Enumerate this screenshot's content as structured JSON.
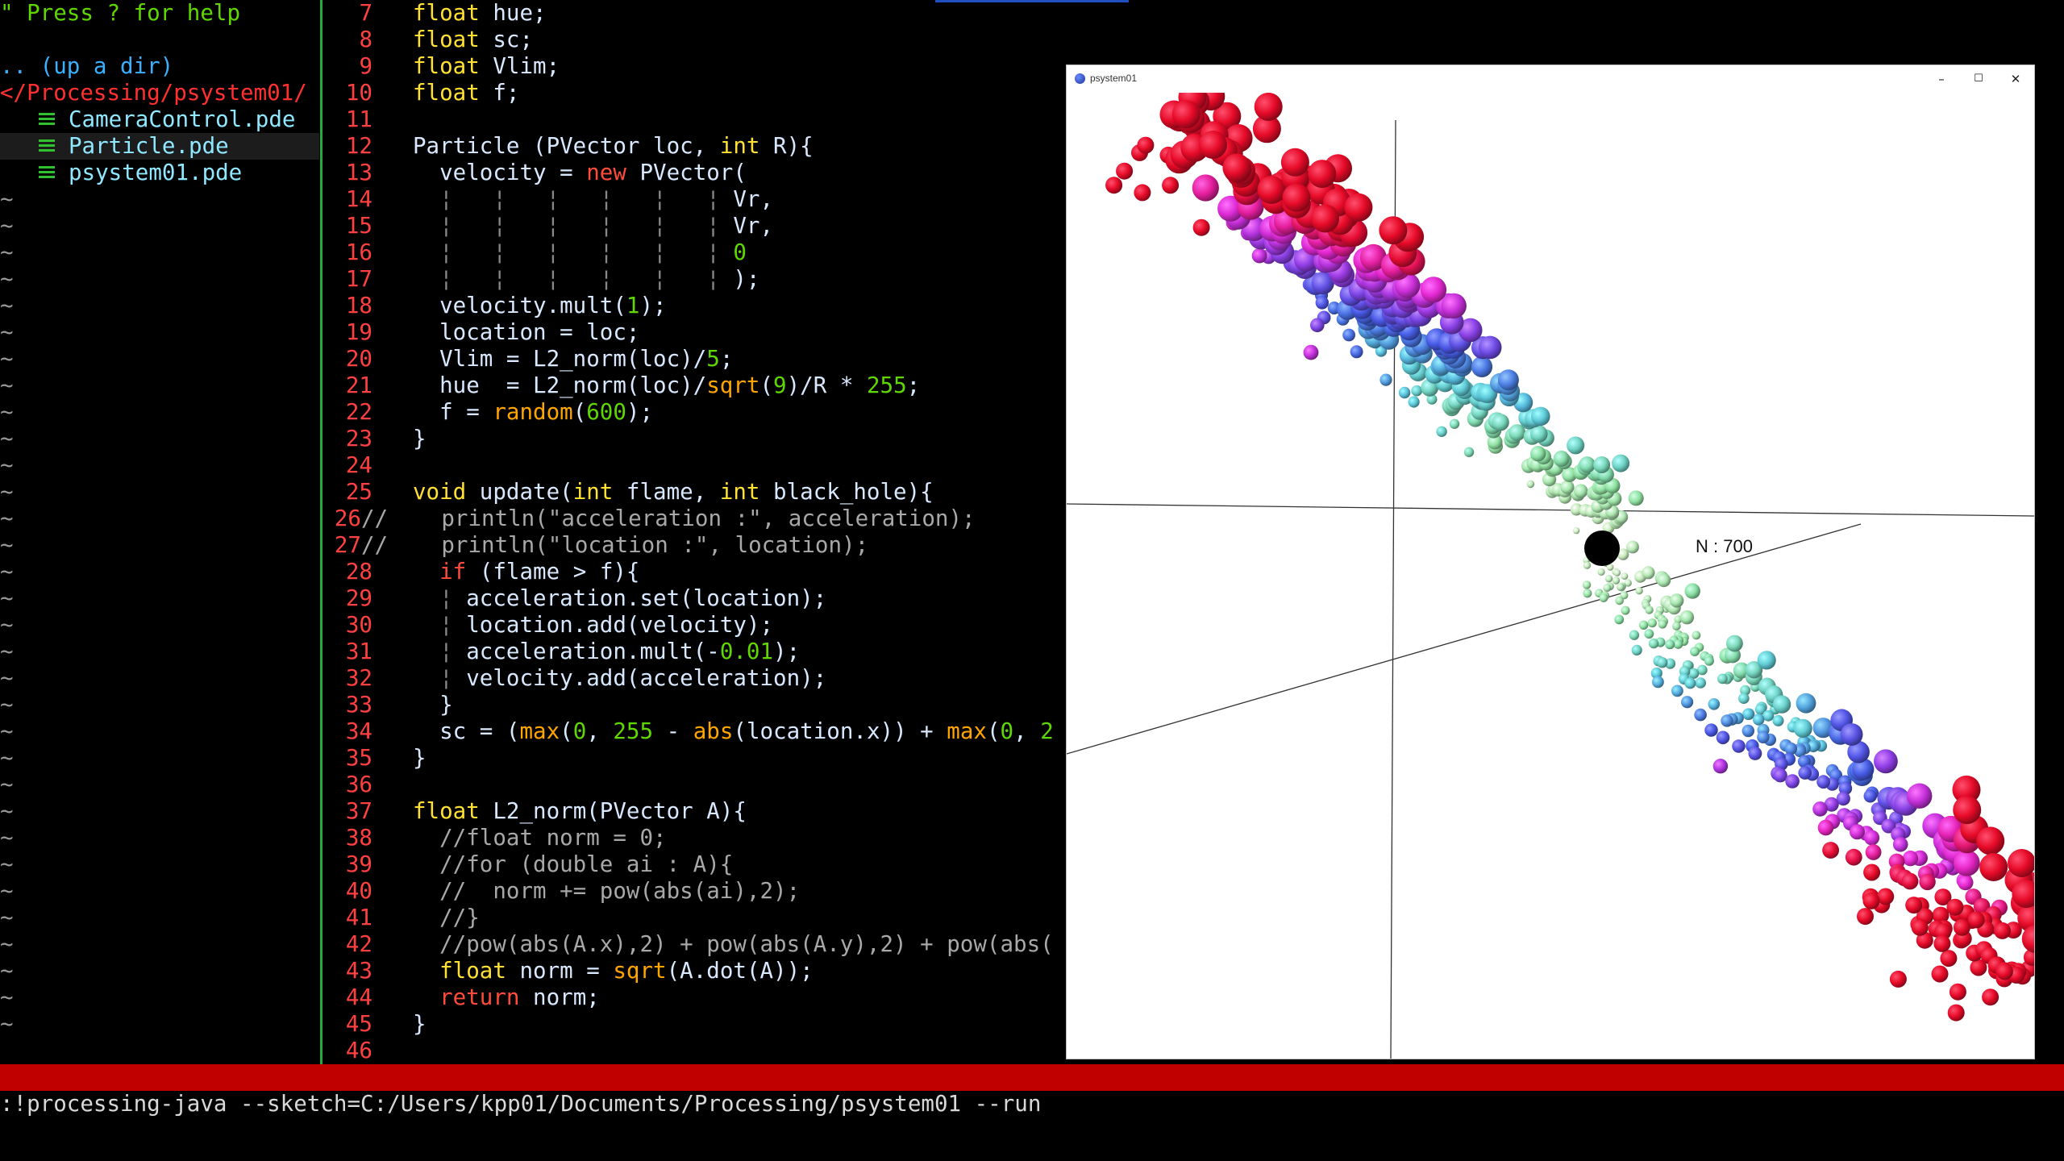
{
  "tree": {
    "help": "\" Press ? for help",
    "up_dir": ".. (up a dir)",
    "path": "</Processing/psystem01/",
    "files": [
      "CameraControl.pde",
      "Particle.pde",
      "psystem01.pde"
    ],
    "selected_index": 1,
    "tilde": "~",
    "tilde_count": 32
  },
  "code": {
    "lines": [
      {
        "n": "7",
        "t": [
          [
            "kw",
            "float"
          ],
          [
            "plain",
            " hue;"
          ]
        ]
      },
      {
        "n": "8",
        "t": [
          [
            "kw",
            "float"
          ],
          [
            "plain",
            " sc;"
          ]
        ]
      },
      {
        "n": "9",
        "t": [
          [
            "kw",
            "float"
          ],
          [
            "plain",
            " Vlim;"
          ]
        ]
      },
      {
        "n": "10",
        "t": [
          [
            "kw",
            "float"
          ],
          [
            "plain",
            " f;"
          ]
        ]
      },
      {
        "n": "11",
        "t": []
      },
      {
        "n": "12",
        "t": [
          [
            "plain",
            "Particle (PVector loc, "
          ],
          [
            "kw",
            "int"
          ],
          [
            "plain",
            " R){"
          ]
        ]
      },
      {
        "n": "13",
        "t": [
          [
            "plain",
            "  velocity = "
          ],
          [
            "kr",
            "new"
          ],
          [
            "plain",
            " PVector("
          ]
        ]
      },
      {
        "n": "14",
        "t": [
          [
            "guide",
            "  ¦   ¦   ¦   ¦   ¦   ¦ "
          ],
          [
            "plain",
            "Vr,"
          ]
        ]
      },
      {
        "n": "15",
        "t": [
          [
            "guide",
            "  ¦   ¦   ¦   ¦   ¦   ¦ "
          ],
          [
            "plain",
            "Vr,"
          ]
        ]
      },
      {
        "n": "16",
        "t": [
          [
            "guide",
            "  ¦   ¦   ¦   ¦   ¦   ¦ "
          ],
          [
            "num",
            "0"
          ]
        ]
      },
      {
        "n": "17",
        "t": [
          [
            "guide",
            "  ¦   ¦   ¦   ¦   ¦   ¦ "
          ],
          [
            "plain",
            ");"
          ]
        ]
      },
      {
        "n": "18",
        "t": [
          [
            "plain",
            "  velocity.mult("
          ],
          [
            "num",
            "1"
          ],
          [
            "plain",
            ");"
          ]
        ]
      },
      {
        "n": "19",
        "t": [
          [
            "plain",
            "  location = loc;"
          ]
        ]
      },
      {
        "n": "20",
        "t": [
          [
            "plain",
            "  Vlim = L2_norm(loc)/"
          ],
          [
            "num",
            "5"
          ],
          [
            "plain",
            ";"
          ]
        ]
      },
      {
        "n": "21",
        "t": [
          [
            "plain",
            "  hue  = L2_norm(loc)/"
          ],
          [
            "fn",
            "sqrt"
          ],
          [
            "plain",
            "("
          ],
          [
            "num",
            "9"
          ],
          [
            "plain",
            ")/R * "
          ],
          [
            "num",
            "255"
          ],
          [
            "plain",
            ";"
          ]
        ]
      },
      {
        "n": "22",
        "t": [
          [
            "plain",
            "  f = "
          ],
          [
            "fn",
            "random"
          ],
          [
            "plain",
            "("
          ],
          [
            "num",
            "600"
          ],
          [
            "plain",
            ");"
          ]
        ]
      },
      {
        "n": "23",
        "t": [
          [
            "plain",
            "}"
          ]
        ]
      },
      {
        "n": "24",
        "t": []
      },
      {
        "n": "25",
        "t": [
          [
            "kw",
            "void"
          ],
          [
            "plain",
            " update("
          ],
          [
            "kw",
            "int"
          ],
          [
            "plain",
            " flame, "
          ],
          [
            "kw",
            "int"
          ],
          [
            "plain",
            " black_hole){"
          ]
        ]
      },
      {
        "n": "26",
        "t": [
          [
            "cmt",
            "//    println(\"acceleration :\", acceleration);"
          ]
        ],
        "out": true
      },
      {
        "n": "27",
        "t": [
          [
            "cmt",
            "//    println(\"location :\", location);"
          ]
        ],
        "out": true
      },
      {
        "n": "28",
        "t": [
          [
            "plain",
            "  "
          ],
          [
            "kr",
            "if"
          ],
          [
            "plain",
            " (flame > f){"
          ]
        ]
      },
      {
        "n": "29",
        "t": [
          [
            "guide",
            "  ¦ "
          ],
          [
            "plain",
            "acceleration.set(location);"
          ]
        ]
      },
      {
        "n": "30",
        "t": [
          [
            "guide",
            "  ¦ "
          ],
          [
            "plain",
            "location.add(velocity);"
          ]
        ]
      },
      {
        "n": "31",
        "t": [
          [
            "guide",
            "  ¦ "
          ],
          [
            "plain",
            "acceleration.mult(-"
          ],
          [
            "num",
            "0.01"
          ],
          [
            "plain",
            ");"
          ]
        ]
      },
      {
        "n": "32",
        "t": [
          [
            "guide",
            "  ¦ "
          ],
          [
            "plain",
            "velocity.add(acceleration);"
          ]
        ]
      },
      {
        "n": "33",
        "t": [
          [
            "plain",
            "  }"
          ]
        ]
      },
      {
        "n": "34",
        "t": [
          [
            "plain",
            "  sc = ("
          ],
          [
            "fn",
            "max"
          ],
          [
            "plain",
            "("
          ],
          [
            "num",
            "0"
          ],
          [
            "plain",
            ", "
          ],
          [
            "num",
            "255"
          ],
          [
            "plain",
            " - "
          ],
          [
            "fn",
            "abs"
          ],
          [
            "plain",
            "(location.x)) + "
          ],
          [
            "fn",
            "max"
          ],
          [
            "plain",
            "("
          ],
          [
            "num",
            "0"
          ],
          [
            "plain",
            ", "
          ],
          [
            "num",
            "2"
          ]
        ]
      },
      {
        "n": "35",
        "t": [
          [
            "plain",
            "}"
          ]
        ]
      },
      {
        "n": "36",
        "t": []
      },
      {
        "n": "37",
        "t": [
          [
            "kw",
            "float"
          ],
          [
            "plain",
            " L2_norm(PVector A){"
          ]
        ]
      },
      {
        "n": "38",
        "t": [
          [
            "cmt",
            "  //float norm = 0;"
          ]
        ]
      },
      {
        "n": "39",
        "t": [
          [
            "cmt",
            "  //for (double ai : A){"
          ]
        ]
      },
      {
        "n": "40",
        "t": [
          [
            "cmt",
            "  //  norm += pow(abs(ai),2);"
          ]
        ]
      },
      {
        "n": "41",
        "t": [
          [
            "cmt",
            "  //}"
          ]
        ]
      },
      {
        "n": "42",
        "t": [
          [
            "cmt",
            "  //pow(abs(A.x),2) + pow(abs(A.y),2) + pow(abs("
          ]
        ]
      },
      {
        "n": "43",
        "t": [
          [
            "plain",
            "  "
          ],
          [
            "kw",
            "float"
          ],
          [
            "plain",
            " norm = "
          ],
          [
            "fn",
            "sqrt"
          ],
          [
            "plain",
            "(A.dot(A));"
          ]
        ]
      },
      {
        "n": "44",
        "t": [
          [
            "plain",
            "  "
          ],
          [
            "kr",
            "return"
          ],
          [
            "plain",
            " norm;"
          ]
        ]
      },
      {
        "n": "45",
        "t": [
          [
            "plain",
            "}"
          ]
        ]
      },
      {
        "n": "46",
        "t": []
      }
    ]
  },
  "command_line": ":!processing-java --sketch=C:/Users/kpp01/Documents/Processing/psystem01 --run",
  "sketch": {
    "title": "psystem01",
    "minimize": "–",
    "maximize": "☐",
    "close": "✕",
    "counter_label": "N : 700"
  },
  "colors": {
    "background": "#000000",
    "line_numbers": "#ff4040",
    "keyword": "#ffe033",
    "function": "#ffa500",
    "number": "#5fd700",
    "status_bar": "#c00000",
    "split_line": "#2ba83a"
  }
}
